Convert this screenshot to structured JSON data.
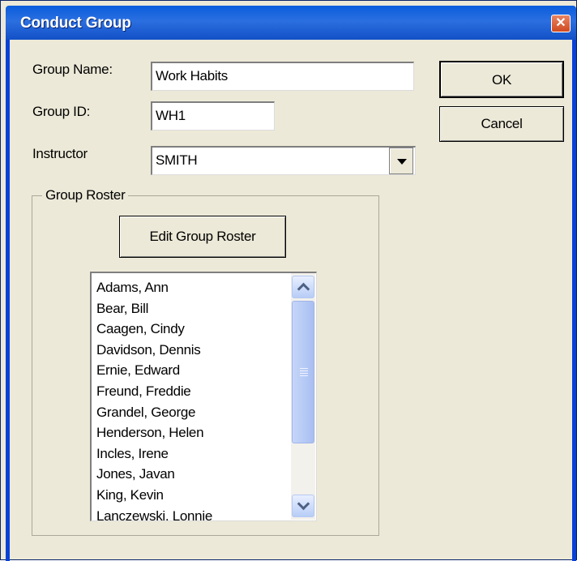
{
  "window": {
    "title": "Conduct Group",
    "close_symbol": "✕"
  },
  "fields": {
    "group_name_label": "Group Name:",
    "group_name_value": "Work Habits",
    "group_id_label": "Group ID:",
    "group_id_value": "WH1",
    "instructor_label": "Instructor",
    "instructor_value": "SMITH"
  },
  "buttons": {
    "ok": "OK",
    "cancel": "Cancel",
    "edit_roster": "Edit Group Roster"
  },
  "roster": {
    "legend": "Group Roster",
    "items": [
      "Adams, Ann",
      "Bear, Bill",
      "Caagen, Cindy",
      "Davidson, Dennis",
      "Ernie, Edward",
      "Freund, Freddie",
      "Grandel, George",
      "Henderson, Helen",
      "Incles, Irene",
      "Jones, Javan",
      "King, Kevin",
      "Lanczewski, Lonnie"
    ]
  },
  "colors": {
    "titlebar": "#0a5ddd",
    "dialog_bg": "#ece9d8",
    "close_button": "#d04a20",
    "scrollbar_thumb": "#b5c9f5"
  },
  "icons": {
    "close": "close-icon",
    "dropdown": "chevron-down-icon",
    "scroll_up": "chevron-up-icon",
    "scroll_down": "chevron-down-icon"
  }
}
